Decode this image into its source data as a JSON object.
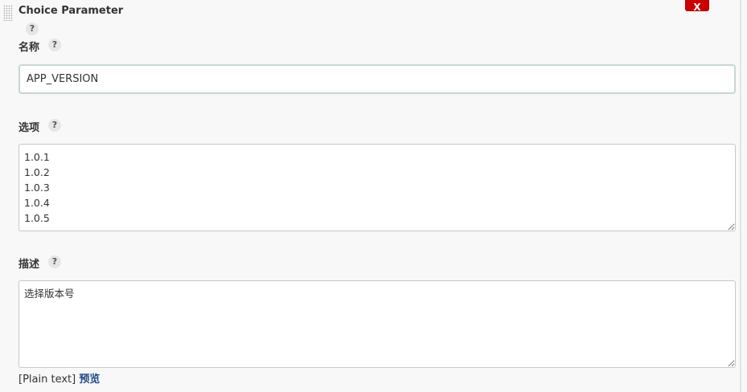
{
  "block": {
    "title": "Choice Parameter",
    "delete_label": "X",
    "help_icon": "?"
  },
  "fields": {
    "name": {
      "label": "名称",
      "value": "APP_VERSION"
    },
    "choices": {
      "label": "选项",
      "value": "1.0.1\n1.0.2\n1.0.3\n1.0.4\n1.0.5"
    },
    "description": {
      "label": "描述",
      "value": "选择版本号"
    }
  },
  "footer": {
    "format": "[Plain text]",
    "preview": "预览"
  },
  "colors": {
    "delete_button": "#cc0000",
    "link": "#204a87",
    "background": "#f8f8f8"
  }
}
